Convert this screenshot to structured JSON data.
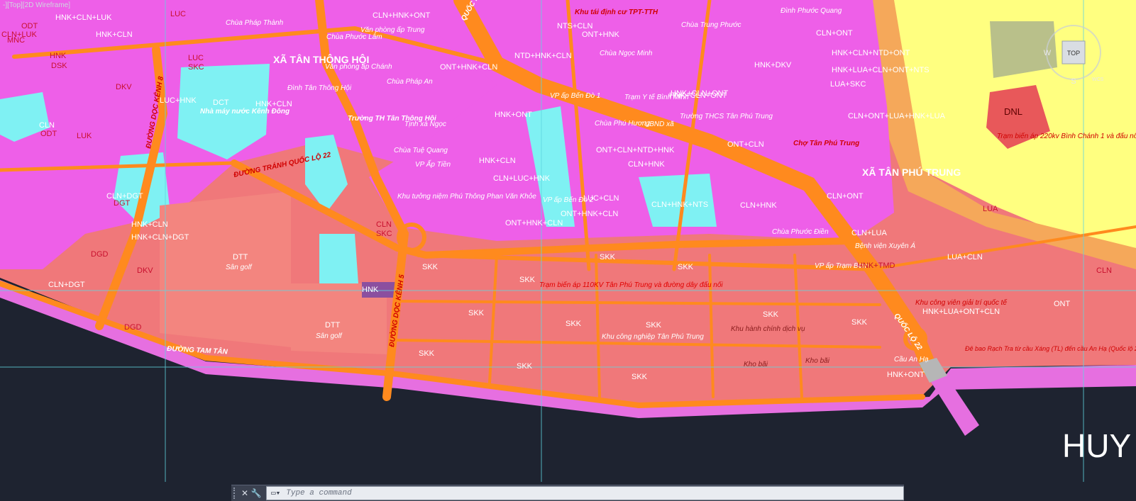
{
  "viewport_label": "-][Top][2D Wireframe]",
  "viewcube": {
    "top": "TOP",
    "west": "W",
    "south": "S",
    "north": "N",
    "wcs": "WCS"
  },
  "command_line": {
    "placeholder": "Type a command",
    "close_icon": "close-icon",
    "settings_icon": "wrench-icon"
  },
  "big_label": "HUY",
  "communes": [
    "XÃ TÂN THÔNG HỘI",
    "XÃ TÂN PHÚ TRUNG"
  ],
  "roads": [
    "ĐƯỜNG DỌC KÊNH 8",
    "ĐƯỜNG TRÁNH QUỐC LỘ 22",
    "ĐƯỜNG DỌC KÊNH 5",
    "ĐƯỜNG TAM TÂN",
    "QUỐC LỘ 22",
    "QUỐC LỘ 22"
  ],
  "places": [
    "Chùa Phước Lâm",
    "Văn phòng ấp Trung",
    "Chùa Pháp Thành",
    "Văn phòng ấp Chánh",
    "Chùa Pháp An",
    "Đình Tân Thông Hội",
    "Trường TH Tân Thông Hội",
    "Tịnh xá Ngọc",
    "Chùa Tuệ Quang",
    "VP Ấp Tiền",
    "Khu tưởng niệm Phú Thông Phan Văn Khỏe",
    "Nhà máy nước Kênh Đông",
    "Sân golf",
    "Sân golf",
    "Khu tái định cư TPT-TTH",
    "Chùa Ngọc Minh",
    "Trạm Y tế Bình Minh",
    "Chùa Phú Hương",
    "UBND xã",
    "Trường THCS Tân Phú Trung",
    "Chợ Tân Phú Trung",
    "VP ấp Bến Đò 1",
    "VP ấp Bến Đò 2",
    "Trạm biến áp 110KV Tân Phú Trung và đường dây đấu nối",
    "Khu công nghiệp Tân Phú Trung",
    "Khu hành chính dịch vụ",
    "Kho bãi",
    "Kho bãi",
    "Chùa Phước Điền",
    "VP ấp Trạm Bơm",
    "Bệnh viện Xuyên Á",
    "Cầu An Hạ",
    "Trạm biến áp 220kv Bình Chánh 1 và đấu nối",
    "Khu công viên giải trí quốc tế",
    "Đê bao Rạch Tra từ cầu Xáng (TL) đến cầu An Hạ (Quốc lộ 22)",
    "Chùa Trung Phước",
    "Đình Phước Quang"
  ],
  "zones": [
    "HNK+CLN+LUK",
    "HNK+CLN",
    "CLN+LUK",
    "HNK",
    "LUC",
    "ODT",
    "MNC",
    "DSK",
    "DKV",
    "LUC",
    "SKC",
    "LUC+HNK",
    "HNK+CLN",
    "ODT",
    "CLN",
    "DGD",
    "DCT",
    "HNK+CLN",
    "DKV",
    "LUK",
    "DGT",
    "HNK+CLN+DGT",
    "DGD",
    "CLN+DGT",
    "CLN+DGT",
    "DTT",
    "DTT",
    "HNK",
    "CLN",
    "SKC",
    "SKK",
    "SKK",
    "SKK",
    "SKK",
    "SKK",
    "SKK",
    "SKK",
    "SKK",
    "SKK",
    "SKK",
    "SKK",
    "SKK",
    "HNK+ONT",
    "CLN+HNK+ONT",
    "NTS+CLN",
    "ONT+HNK",
    "NTD+HNK+CLN",
    "ONT+HNK+CLN",
    "HNK+ONT",
    "HNK+CLN",
    "CLN+LUC+HNK",
    "ONT+CLN+NTD+HNK",
    "CLN+HNK",
    "LUC+CLN",
    "CLN+HNK+NTS",
    "ONT+HNK+CLN",
    "ONT+HNK+CLN",
    "CLN+HNK",
    "HNK+CLN+ONT",
    "HNK+CLN+NTD+ONT",
    "HNK+LUA+CLN+ONT+NTS",
    "LUA+SKC",
    "CLN+ONT+LUA+HNK+LUA",
    "HNK+DKV",
    "ONT+CLN",
    "CLN+ONT",
    "CLN+LUA",
    "HNK+TMD",
    "LUA+CLN",
    "HNK+LUA+ONT+CLN",
    "DNL",
    "LUA",
    "CLN",
    "ONT",
    "CLN+ONT",
    "HNK+CLN+ONT"
  ]
}
